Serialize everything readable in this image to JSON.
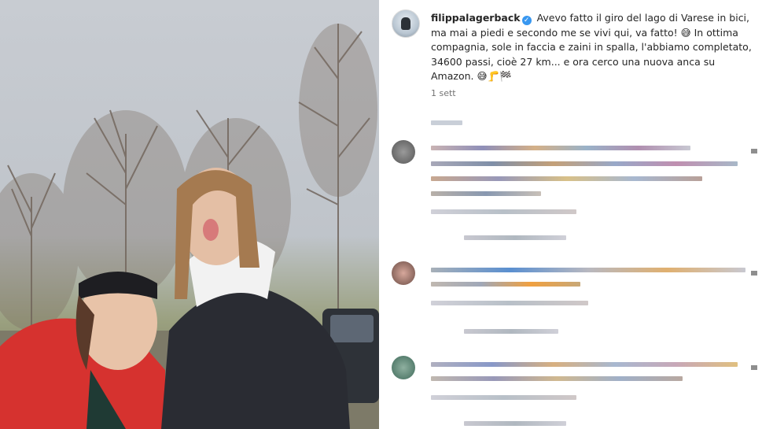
{
  "post": {
    "username": "filippalagerback",
    "verified_badge": "✓",
    "caption": "Avevo fatto il giro del lago di Varese in bici, ma mai a piedi e secondo me se vivi qui, va fatto! 😅 In ottima compagnia, sole in faccia e zaini in spalla, l'abbiamo completato, 34600 passi, cioè 27 km... e ora cerco una nuova anca su Amazon. 😅🦵🏁",
    "time": "1 sett"
  },
  "colors": {
    "link": "#3897f0",
    "text": "#262626",
    "muted": "#737373"
  }
}
